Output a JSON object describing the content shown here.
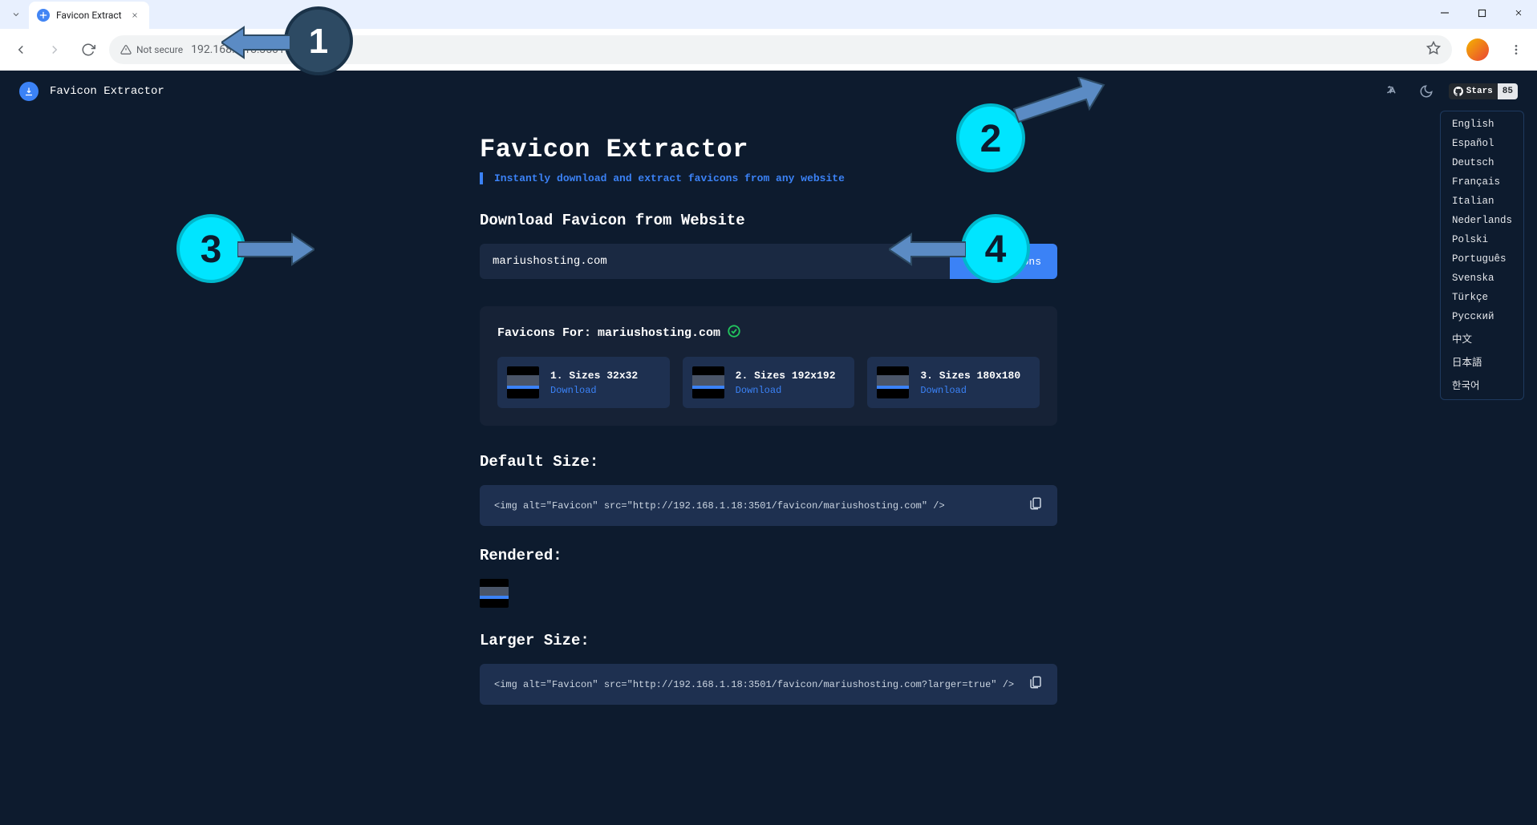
{
  "browser": {
    "tab_title": "Favicon Extract",
    "security_label": "Not secure",
    "url": "192.168.1.18:3501"
  },
  "header": {
    "brand": "Favicon Extractor",
    "github_stars_label": "Stars",
    "github_stars_count": "85"
  },
  "page": {
    "title": "Favicon Extractor",
    "subtitle": "Instantly download and extract favicons from any website",
    "download_heading": "Download Favicon from Website",
    "input_value": "mariushosting.com",
    "button_label": "Get Favicons",
    "results_prefix": "Favicons For:",
    "results_domain": "mariushosting.com",
    "favicons": [
      {
        "label": "1. Sizes 32x32",
        "action": "Download"
      },
      {
        "label": "2. Sizes 192x192",
        "action": "Download"
      },
      {
        "label": "3. Sizes 180x180",
        "action": "Download"
      }
    ],
    "default_heading": "Default Size:",
    "default_code": "<img alt=\"Favicon\" src=\"http://192.168.1.18:3501/favicon/mariushosting.com\" />",
    "rendered_heading": "Rendered:",
    "larger_heading": "Larger Size:",
    "larger_code": "<img alt=\"Favicon\" src=\"http://192.168.1.18:3501/favicon/mariushosting.com?larger=true\" />"
  },
  "languages": [
    "English",
    "Español",
    "Deutsch",
    "Français",
    "Italian",
    "Nederlands",
    "Polski",
    "Português",
    "Svenska",
    "Türkçe",
    "Русский",
    "中文",
    "日本語",
    "한국어"
  ],
  "annotations": {
    "n1": "1",
    "n2": "2",
    "n3": "3",
    "n4": "4"
  }
}
